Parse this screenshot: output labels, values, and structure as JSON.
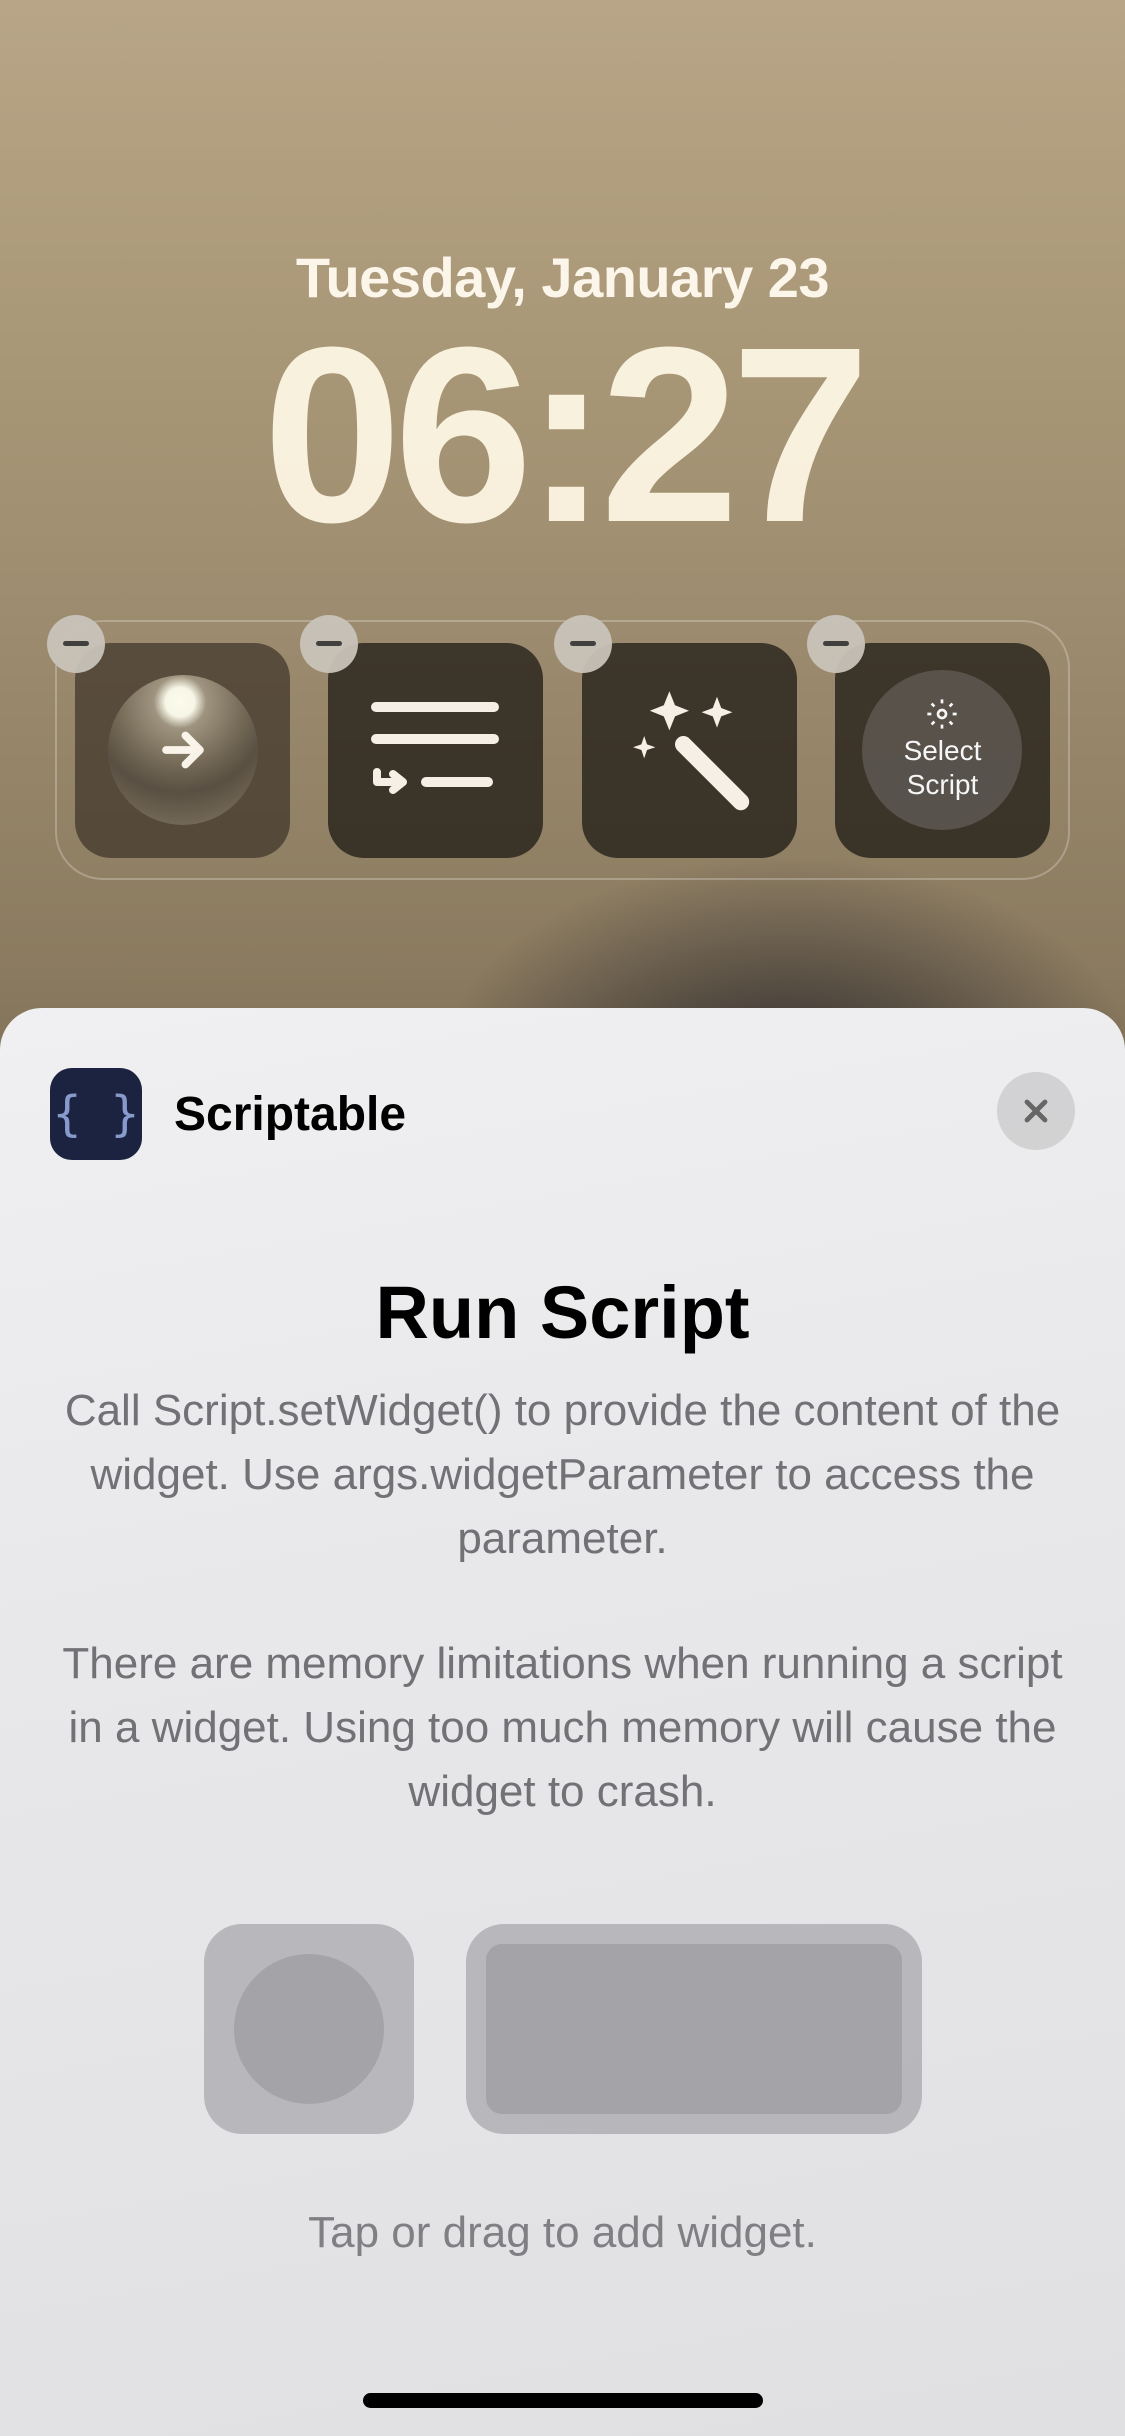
{
  "lockscreen": {
    "date": "Tuesday, January 23",
    "time": "06:27"
  },
  "widgets": {
    "slot4": {
      "label": "Select\nScript"
    }
  },
  "sheet": {
    "app_name": "Scriptable",
    "title": "Run Script",
    "description_1": "Call Script.setWidget() to provide the content of the widget. Use args.widgetParameter to access the parameter.",
    "description_2": "There are memory limitations when running a script in a widget. Using too much memory will cause the widget to crash.",
    "hint": "Tap or drag to add widget."
  }
}
